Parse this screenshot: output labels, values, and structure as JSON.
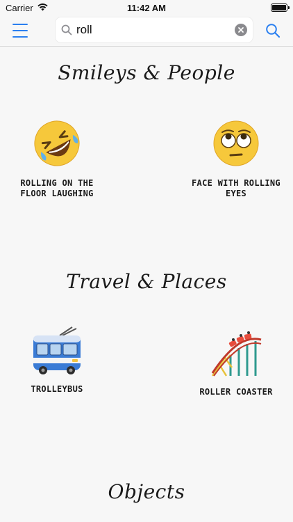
{
  "status_bar": {
    "carrier": "Carrier",
    "time": "11:42 AM"
  },
  "top_bar": {
    "menu_icon": "hamburger-menu-icon",
    "search": {
      "value": "roll",
      "placeholder": "Search"
    },
    "search_button_icon": "search-icon"
  },
  "sections": [
    {
      "title": "Smileys & People",
      "items": [
        {
          "label": "ROLLING ON THE FLOOR LAUGHING",
          "icon": "rolling-on-the-floor-laughing-emoji"
        },
        {
          "label": "FACE WITH ROLLING EYES",
          "icon": "face-with-rolling-eyes-emoji"
        }
      ]
    },
    {
      "title": "Travel & Places",
      "items": [
        {
          "label": "TROLLEYBUS",
          "icon": "trolleybus-emoji"
        },
        {
          "label": "ROLLER COASTER",
          "icon": "roller-coaster-emoji"
        }
      ]
    },
    {
      "title": "Objects",
      "items": []
    }
  ],
  "colors": {
    "accent": "#2a7ff0",
    "background": "#f7f7f7"
  }
}
